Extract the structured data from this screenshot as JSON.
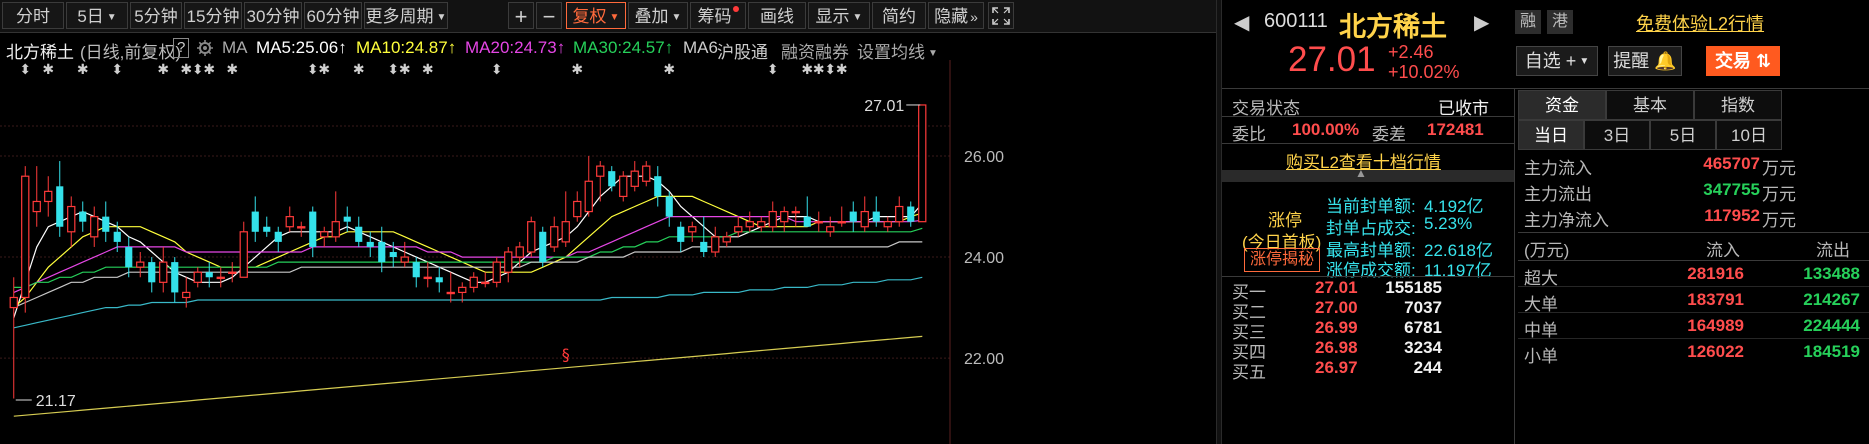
{
  "toolbar": {
    "items": [
      "分时",
      "5日",
      "5分钟",
      "15分钟",
      "30分钟",
      "60分钟",
      "更多周期"
    ],
    "plus": "+",
    "minus": "−",
    "fuquan": "复权",
    "diejia": "叠加",
    "chouma": "筹码",
    "huaxian": "画线",
    "xianshi": "显示",
    "jiancao": "简约",
    "yincang": "隐藏",
    "yincang_arrows": "»"
  },
  "chart_header": {
    "name": "北方稀土",
    "mode": "(日线,前复权)",
    "help": "?",
    "ma_label": "MA",
    "ma5": "MA5:25.06",
    "ma10": "MA10:24.87",
    "ma20": "MA20:24.73",
    "ma30": "MA30:24.57",
    "ma6": "MA6",
    "hgt": "沪股通",
    "rzrq": "融资融券",
    "settings": "设置均线"
  },
  "chart_data": {
    "type": "candlestick",
    "ylim": [
      20.3,
      27.9
    ],
    "yticks": [
      "26.00",
      "24.00",
      "22.00"
    ],
    "high_label": "27.01",
    "low_label": "21.17",
    "candles": [
      [
        23.0,
        23.2,
        23.6,
        21.2
      ],
      [
        23.2,
        25.6,
        25.8,
        22.9
      ],
      [
        24.9,
        25.1,
        25.8,
        24.6
      ],
      [
        25.1,
        25.3,
        25.6,
        24.8
      ],
      [
        25.4,
        24.6,
        25.9,
        24.4
      ],
      [
        24.5,
        25.0,
        25.2,
        24.2
      ],
      [
        24.9,
        24.7,
        25.1,
        24.5
      ],
      [
        24.4,
        24.8,
        25.0,
        24.2
      ],
      [
        24.8,
        24.5,
        25.1,
        24.3
      ],
      [
        24.5,
        24.3,
        24.7,
        24.1
      ],
      [
        24.2,
        23.8,
        24.4,
        23.6
      ],
      [
        23.8,
        23.9,
        24.1,
        23.6
      ],
      [
        23.9,
        23.5,
        24.0,
        23.3
      ],
      [
        23.5,
        23.9,
        24.2,
        23.3
      ],
      [
        23.9,
        23.3,
        24.0,
        23.1
      ],
      [
        23.2,
        23.3,
        23.6,
        23.0
      ],
      [
        23.5,
        23.7,
        23.8,
        23.4
      ],
      [
        23.7,
        23.6,
        23.9,
        23.4
      ],
      [
        23.6,
        23.6,
        23.8,
        23.4
      ],
      [
        23.7,
        23.7,
        23.9,
        23.5
      ],
      [
        23.6,
        24.5,
        24.7,
        23.6
      ],
      [
        24.9,
        24.5,
        25.2,
        24.3
      ],
      [
        24.6,
        24.5,
        24.8,
        24.4
      ],
      [
        24.5,
        24.3,
        24.6,
        24.1
      ],
      [
        24.6,
        24.8,
        25.0,
        24.5
      ],
      [
        24.6,
        24.6,
        24.7,
        24.4
      ],
      [
        24.9,
        24.2,
        25.0,
        24.0
      ],
      [
        24.4,
        24.5,
        24.6,
        24.2
      ],
      [
        24.4,
        24.7,
        25.3,
        24.3
      ],
      [
        24.8,
        24.7,
        25.0,
        24.5
      ],
      [
        24.6,
        24.3,
        24.8,
        24.2
      ],
      [
        24.3,
        24.2,
        24.5,
        24.0
      ],
      [
        24.3,
        23.9,
        24.6,
        23.7
      ],
      [
        24.1,
        24.0,
        24.3,
        23.8
      ],
      [
        23.9,
        24.0,
        24.3,
        23.8
      ],
      [
        23.9,
        23.6,
        24.0,
        23.4
      ],
      [
        23.6,
        23.6,
        23.9,
        23.4
      ],
      [
        23.6,
        23.5,
        23.8,
        23.3
      ],
      [
        23.3,
        23.3,
        23.7,
        23.1
      ],
      [
        23.3,
        23.4,
        23.5,
        23.1
      ],
      [
        23.4,
        23.6,
        23.7,
        23.3
      ],
      [
        23.5,
        23.5,
        23.7,
        23.4
      ],
      [
        23.5,
        23.9,
        24.0,
        23.4
      ],
      [
        23.7,
        24.1,
        24.2,
        23.5
      ],
      [
        24.0,
        24.2,
        24.3,
        23.8
      ],
      [
        24.1,
        24.7,
        24.8,
        24.0
      ],
      [
        24.5,
        23.9,
        24.6,
        23.8
      ],
      [
        24.2,
        24.6,
        24.8,
        24.1
      ],
      [
        24.3,
        24.7,
        25.3,
        24.2
      ],
      [
        24.8,
        25.1,
        25.3,
        24.7
      ],
      [
        24.9,
        25.5,
        26.0,
        24.8
      ],
      [
        25.6,
        25.8,
        25.9,
        25.1
      ],
      [
        25.7,
        25.4,
        25.8,
        25.3
      ],
      [
        25.2,
        25.6,
        25.7,
        25.1
      ],
      [
        25.4,
        25.7,
        25.9,
        25.3
      ],
      [
        25.5,
        25.8,
        25.9,
        25.4
      ],
      [
        25.6,
        25.2,
        25.8,
        25.0
      ],
      [
        25.2,
        24.8,
        25.3,
        24.6
      ],
      [
        24.6,
        24.3,
        24.7,
        24.1
      ],
      [
        24.5,
        24.6,
        24.7,
        24.3
      ],
      [
        24.3,
        24.1,
        24.8,
        24.0
      ],
      [
        24.1,
        24.4,
        24.6,
        24.0
      ],
      [
        24.3,
        24.4,
        24.5,
        24.2
      ],
      [
        24.5,
        24.6,
        24.8,
        24.4
      ],
      [
        24.6,
        24.7,
        24.9,
        24.5
      ],
      [
        24.6,
        24.7,
        24.8,
        24.5
      ],
      [
        24.6,
        24.9,
        25.1,
        24.5
      ],
      [
        24.7,
        24.9,
        25.0,
        24.5
      ],
      [
        24.9,
        24.9,
        25.0,
        24.6
      ],
      [
        24.8,
        24.6,
        25.2,
        24.6
      ],
      [
        24.7,
        24.7,
        24.9,
        24.5
      ],
      [
        24.5,
        24.6,
        24.8,
        24.4
      ],
      [
        24.7,
        24.7,
        25.0,
        24.6
      ],
      [
        24.9,
        24.7,
        25.1,
        24.5
      ],
      [
        24.6,
        24.9,
        25.2,
        24.5
      ],
      [
        24.9,
        24.7,
        25.2,
        24.6
      ],
      [
        24.6,
        24.7,
        24.8,
        24.5
      ],
      [
        24.7,
        25.0,
        25.2,
        24.6
      ],
      [
        25.0,
        24.7,
        25.1,
        24.6
      ],
      [
        24.7,
        27.01,
        27.01,
        25.8
      ]
    ],
    "ma_lines": [
      {
        "name": "MA5",
        "color": "#ffffff",
        "values": [
          22.8,
          23.5,
          24.2,
          24.6,
          24.7,
          24.8,
          24.9,
          24.8,
          24.7,
          24.6,
          24.4,
          24.3,
          24.1,
          23.9,
          23.7,
          23.6,
          23.5,
          23.5,
          23.5,
          23.6,
          23.8,
          24.0,
          24.2,
          24.4,
          24.5,
          24.5,
          24.5,
          24.5,
          24.5,
          24.6,
          24.5,
          24.4,
          24.3,
          24.2,
          24.1,
          24.0,
          23.9,
          23.8,
          23.7,
          23.6,
          23.5,
          23.5,
          23.6,
          23.7,
          23.9,
          24.1,
          24.2,
          24.3,
          24.4,
          24.6,
          24.9,
          25.2,
          25.4,
          25.6,
          25.6,
          25.6,
          25.5,
          25.3,
          25.0,
          24.8,
          24.6,
          24.4,
          24.4,
          24.4,
          24.5,
          24.6,
          24.7,
          24.8,
          24.8,
          24.8,
          24.7,
          24.7,
          24.7,
          24.7,
          24.7,
          24.8,
          24.8,
          24.8,
          24.8,
          25.06
        ]
      },
      {
        "name": "MA10",
        "color": "#ffff3c",
        "values": [
          23.0,
          23.2,
          23.5,
          23.8,
          24.0,
          24.2,
          24.4,
          24.5,
          24.6,
          24.6,
          24.6,
          24.6,
          24.5,
          24.4,
          24.3,
          24.1,
          24.0,
          23.9,
          23.8,
          23.8,
          23.8,
          23.8,
          23.9,
          24.0,
          24.1,
          24.2,
          24.3,
          24.4,
          24.4,
          24.5,
          24.5,
          24.5,
          24.5,
          24.5,
          24.4,
          24.3,
          24.2,
          24.1,
          24.0,
          23.9,
          23.8,
          23.7,
          23.7,
          23.7,
          23.7,
          23.7,
          23.8,
          23.9,
          24.0,
          24.2,
          24.4,
          24.6,
          24.8,
          24.9,
          25.0,
          25.1,
          25.2,
          25.2,
          25.2,
          25.2,
          25.1,
          25.0,
          24.9,
          24.8,
          24.7,
          24.6,
          24.6,
          24.6,
          24.6,
          24.6,
          24.7,
          24.7,
          24.7,
          24.7,
          24.7,
          24.7,
          24.7,
          24.7,
          24.8,
          24.87
        ]
      },
      {
        "name": "MA20",
        "color": "#e546e5",
        "values": [
          23.3,
          23.4,
          23.5,
          23.6,
          23.7,
          23.8,
          23.9,
          24.0,
          24.1,
          24.2,
          24.2,
          24.2,
          24.2,
          24.2,
          24.2,
          24.1,
          24.1,
          24.1,
          24.1,
          24.1,
          24.1,
          24.1,
          24.1,
          24.1,
          24.1,
          24.1,
          24.2,
          24.2,
          24.2,
          24.2,
          24.2,
          24.2,
          24.2,
          24.2,
          24.2,
          24.2,
          24.1,
          24.1,
          24.1,
          24.0,
          24.0,
          24.0,
          24.0,
          24.0,
          24.0,
          24.0,
          24.0,
          24.0,
          24.0,
          24.1,
          24.1,
          24.2,
          24.3,
          24.4,
          24.5,
          24.6,
          24.7,
          24.8,
          24.8,
          24.8,
          24.8,
          24.8,
          24.8,
          24.8,
          24.8,
          24.8,
          24.8,
          24.8,
          24.7,
          24.7,
          24.7,
          24.7,
          24.7,
          24.7,
          24.7,
          24.7,
          24.7,
          24.7,
          24.7,
          24.73
        ]
      },
      {
        "name": "MA30",
        "color": "#26d05a",
        "values": [
          23.4,
          23.4,
          23.5,
          23.5,
          23.6,
          23.6,
          23.7,
          23.7,
          23.8,
          23.8,
          23.8,
          23.8,
          23.8,
          23.8,
          23.8,
          23.8,
          23.8,
          23.8,
          23.8,
          23.8,
          23.8,
          23.8,
          23.8,
          23.9,
          23.9,
          23.9,
          23.9,
          23.9,
          23.9,
          23.9,
          23.9,
          23.9,
          23.9,
          23.9,
          23.9,
          23.9,
          23.9,
          23.9,
          23.9,
          23.9,
          23.9,
          23.9,
          23.9,
          23.9,
          23.9,
          23.9,
          23.9,
          24.0,
          24.0,
          24.0,
          24.0,
          24.1,
          24.1,
          24.2,
          24.2,
          24.3,
          24.3,
          24.4,
          24.4,
          24.4,
          24.4,
          24.4,
          24.4,
          24.5,
          24.5,
          24.5,
          24.5,
          24.5,
          24.5,
          24.5,
          24.5,
          24.5,
          24.5,
          24.5,
          24.5,
          24.5,
          24.5,
          24.5,
          24.5,
          24.57
        ]
      },
      {
        "name": "MA60",
        "color": "#c8c8c8",
        "values": [
          23.0,
          23.1,
          23.2,
          23.3,
          23.4,
          23.5,
          23.5,
          23.6,
          23.6,
          23.6,
          23.7,
          23.7,
          23.7,
          23.7,
          23.7,
          23.7,
          23.7,
          23.7,
          23.7,
          23.7,
          23.7,
          23.7,
          23.7,
          23.7,
          23.7,
          23.8,
          23.8,
          23.8,
          23.8,
          23.8,
          23.8,
          23.8,
          23.8,
          23.8,
          23.8,
          23.8,
          23.8,
          23.8,
          23.8,
          23.8,
          23.8,
          23.8,
          23.8,
          23.8,
          23.8,
          23.9,
          23.9,
          23.9,
          23.9,
          23.9,
          24.0,
          24.0,
          24.0,
          24.0,
          24.1,
          24.1,
          24.1,
          24.1,
          24.1,
          24.2,
          24.2,
          24.2,
          24.2,
          24.2,
          24.2,
          24.2,
          24.2,
          24.2,
          24.2,
          24.2,
          24.2,
          24.2,
          24.2,
          24.2,
          24.2,
          24.2,
          24.2,
          24.3,
          24.3,
          24.3
        ]
      },
      {
        "name": "MA120",
        "color": "#39b9c8",
        "values": [
          22.6,
          22.65,
          22.7,
          22.75,
          22.8,
          22.85,
          22.9,
          22.95,
          23.0,
          23.0,
          23.05,
          23.05,
          23.1,
          23.1,
          23.1,
          23.1,
          23.15,
          23.15,
          23.15,
          23.15,
          23.15,
          23.15,
          23.15,
          23.15,
          23.15,
          23.15,
          23.15,
          23.15,
          23.15,
          23.15,
          23.15,
          23.15,
          23.15,
          23.15,
          23.15,
          23.15,
          23.15,
          23.15,
          23.15,
          23.15,
          23.15,
          23.15,
          23.15,
          23.15,
          23.15,
          23.15,
          23.15,
          23.15,
          23.15,
          23.15,
          23.15,
          23.15,
          23.2,
          23.2,
          23.2,
          23.2,
          23.2,
          23.25,
          23.25,
          23.25,
          23.3,
          23.3,
          23.3,
          23.3,
          23.35,
          23.35,
          23.35,
          23.4,
          23.4,
          23.4,
          23.45,
          23.45,
          23.45,
          23.5,
          23.5,
          23.5,
          23.55,
          23.55,
          23.55,
          23.6
        ]
      },
      {
        "name": "MA250",
        "color": "#d6cc52",
        "values": [
          20.85,
          20.87,
          20.89,
          20.91,
          20.93,
          20.95,
          20.97,
          20.99,
          21.01,
          21.03,
          21.05,
          21.07,
          21.09,
          21.11,
          21.13,
          21.15,
          21.17,
          21.19,
          21.21,
          21.23,
          21.25,
          21.27,
          21.29,
          21.31,
          21.33,
          21.35,
          21.37,
          21.39,
          21.41,
          21.43,
          21.45,
          21.47,
          21.49,
          21.51,
          21.53,
          21.55,
          21.57,
          21.59,
          21.61,
          21.63,
          21.65,
          21.67,
          21.69,
          21.71,
          21.73,
          21.75,
          21.77,
          21.79,
          21.81,
          21.83,
          21.85,
          21.87,
          21.89,
          21.91,
          21.93,
          21.95,
          21.97,
          21.99,
          22.01,
          22.03,
          22.05,
          22.07,
          22.09,
          22.11,
          22.13,
          22.15,
          22.17,
          22.19,
          22.21,
          22.23,
          22.25,
          22.27,
          22.29,
          22.31,
          22.33,
          22.35,
          22.37,
          22.39,
          22.41,
          22.43
        ]
      }
    ]
  },
  "markers": {
    "star": "✱",
    "updown": "⬍",
    "dollar": "§"
  },
  "stock": {
    "code": "600111",
    "name": "北方稀土",
    "tag_rong": "融",
    "tag_gang": "港",
    "promo": "免费体验L2行情",
    "price": "27.01",
    "change": "+2.46",
    "pct": "+10.02%",
    "zixuan": "自选",
    "zixuan_plus": "+",
    "tixing": "提醒",
    "jiaoyi": "交易",
    "jiaoyi_icon": "⇅"
  },
  "trade": {
    "status_label": "交易状态",
    "status_value": "已收市",
    "weibi_label": "委比",
    "weibi_value": "100.00%",
    "weicha_label": "委差",
    "weicha_value": "172481",
    "l2_link": "购买L2查看十档行情"
  },
  "limit_up": {
    "title": "涨停",
    "sub": "(今日首板)",
    "btn": "涨停揭秘",
    "rows": [
      {
        "label": "当前封单额:",
        "value": "4.192亿"
      },
      {
        "label": "封单占成交:",
        "value": "5.23%"
      },
      {
        "label": "最高封单额:",
        "value": "22.618亿"
      },
      {
        "label": "涨停成交额:",
        "value": "11.197亿"
      }
    ]
  },
  "bids": [
    {
      "label": "买一",
      "price": "27.01",
      "vol": "155185"
    },
    {
      "label": "买二",
      "price": "27.00",
      "vol": "7037"
    },
    {
      "label": "买三",
      "price": "26.99",
      "vol": "6781"
    },
    {
      "label": "买四",
      "price": "26.98",
      "vol": "3234"
    },
    {
      "label": "买五",
      "price": "26.97",
      "vol": "244"
    }
  ],
  "fund": {
    "tabs": [
      "资金",
      "基本",
      "指数"
    ],
    "periods": [
      "当日",
      "3日",
      "5日",
      "10日"
    ],
    "flows": [
      {
        "label": "主力流入",
        "value": "465707",
        "unit": "万元",
        "color": "red"
      },
      {
        "label": "主力流出",
        "value": "347755",
        "unit": "万元",
        "color": "green"
      },
      {
        "label": "主力净流入",
        "value": "117952",
        "unit": "万元",
        "color": "red"
      }
    ],
    "table_head": [
      "(万元)",
      "流入",
      "流出"
    ],
    "rows": [
      {
        "label": "超大",
        "in": "281916",
        "out": "133488"
      },
      {
        "label": "大单",
        "in": "183791",
        "out": "214267"
      },
      {
        "label": "中单",
        "in": "164989",
        "out": "224444"
      },
      {
        "label": "小单",
        "in": "126022",
        "out": "184519"
      }
    ]
  }
}
